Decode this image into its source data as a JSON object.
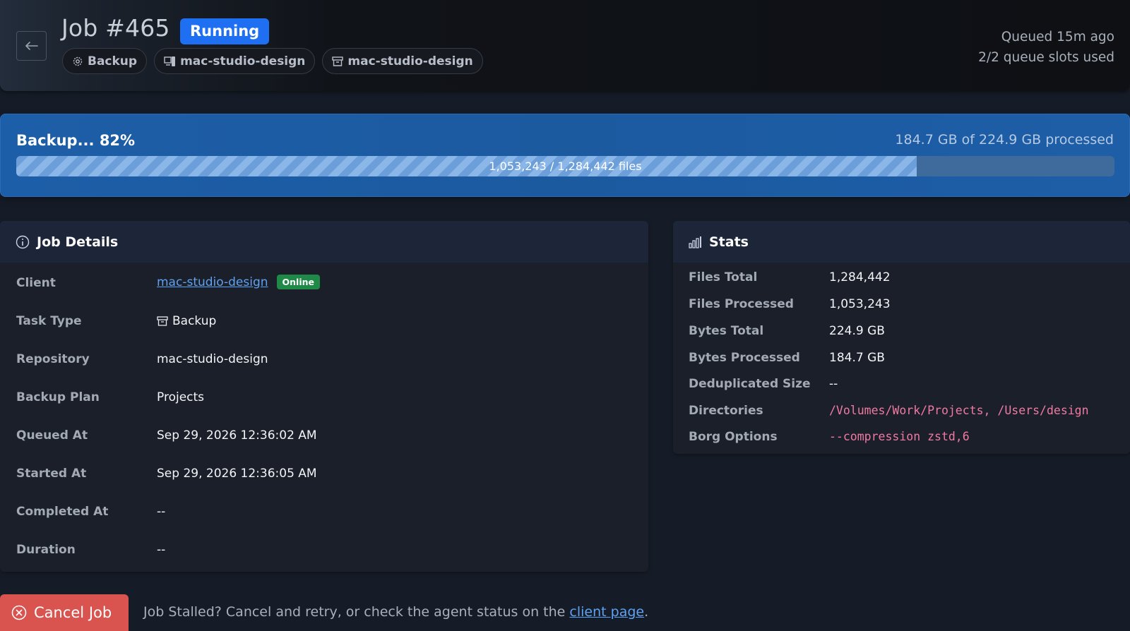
{
  "header": {
    "back_icon": "arrow-left-icon",
    "title": "Job #465",
    "status": "Running",
    "status_color": "#1f6ff2",
    "chips": [
      {
        "label": "Backup",
        "icon": "gear-icon"
      },
      {
        "label": "mac-studio-design",
        "icon": "device-icon"
      },
      {
        "label": "mac-studio-design",
        "icon": "archive-icon"
      }
    ],
    "queued": "Queued 15m ago",
    "slots": "2/2 queue slots used"
  },
  "progress": {
    "label": "Backup... 82%",
    "percent": 82,
    "bytes": "184.7 GB of 224.9 GB processed",
    "files": "1,053,243 / 1,284,442 files"
  },
  "details": {
    "title": "Job Details",
    "icon": "info-icon",
    "client_label": "Client",
    "client_value": "mac-studio-design",
    "client_status": "Online",
    "task_label": "Task Type",
    "task_value": "Backup",
    "repo_label": "Repository",
    "repo_value": "mac-studio-design",
    "plan_label": "Backup Plan",
    "plan_value": "Projects",
    "queued_label": "Queued At",
    "queued_value": "Sep 29, 2026 12:36:02 AM",
    "started_label": "Started At",
    "started_value": "Sep 29, 2026 12:36:05 AM",
    "completed_label": "Completed At",
    "completed_value": "--",
    "duration_label": "Duration",
    "duration_value": "--"
  },
  "stats": {
    "title": "Stats",
    "icon": "bar-chart-icon",
    "rows": [
      {
        "label": "Files Total",
        "value": "1,284,442"
      },
      {
        "label": "Files Processed",
        "value": "1,053,243"
      },
      {
        "label": "Bytes Total",
        "value": "224.9 GB"
      },
      {
        "label": "Bytes Processed",
        "value": "184.7 GB"
      },
      {
        "label": "Deduplicated Size",
        "value": "--"
      },
      {
        "label": "Directories",
        "value": "/Volumes/Work/Projects, /Users/design"
      },
      {
        "label": "Borg Options",
        "value": "--compression zstd,6"
      }
    ]
  },
  "footer": {
    "cancel_label": "Cancel Job",
    "note_prefix": "Job Stalled? Cancel and retry, or check the agent status on the ",
    "note_link": "client page",
    "note_suffix": "."
  }
}
